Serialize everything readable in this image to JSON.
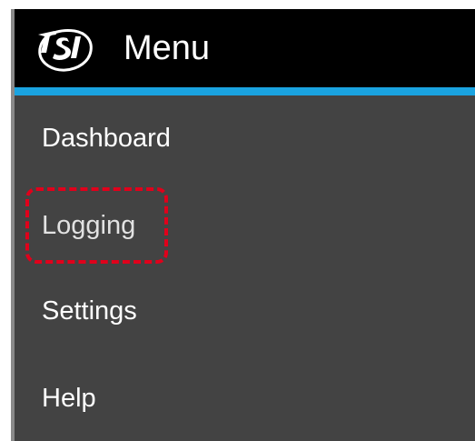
{
  "header": {
    "title": "Menu",
    "logo_icon": "tsi-logo-icon"
  },
  "colors": {
    "header_bg": "#000000",
    "accent": "#1aa3e0",
    "panel_bg": "#434343",
    "highlight": "#e0001b"
  },
  "menu": {
    "items": [
      {
        "label": "Dashboard"
      },
      {
        "label": "Logging",
        "highlighted": true
      },
      {
        "label": "Settings"
      },
      {
        "label": "Help"
      }
    ]
  }
}
